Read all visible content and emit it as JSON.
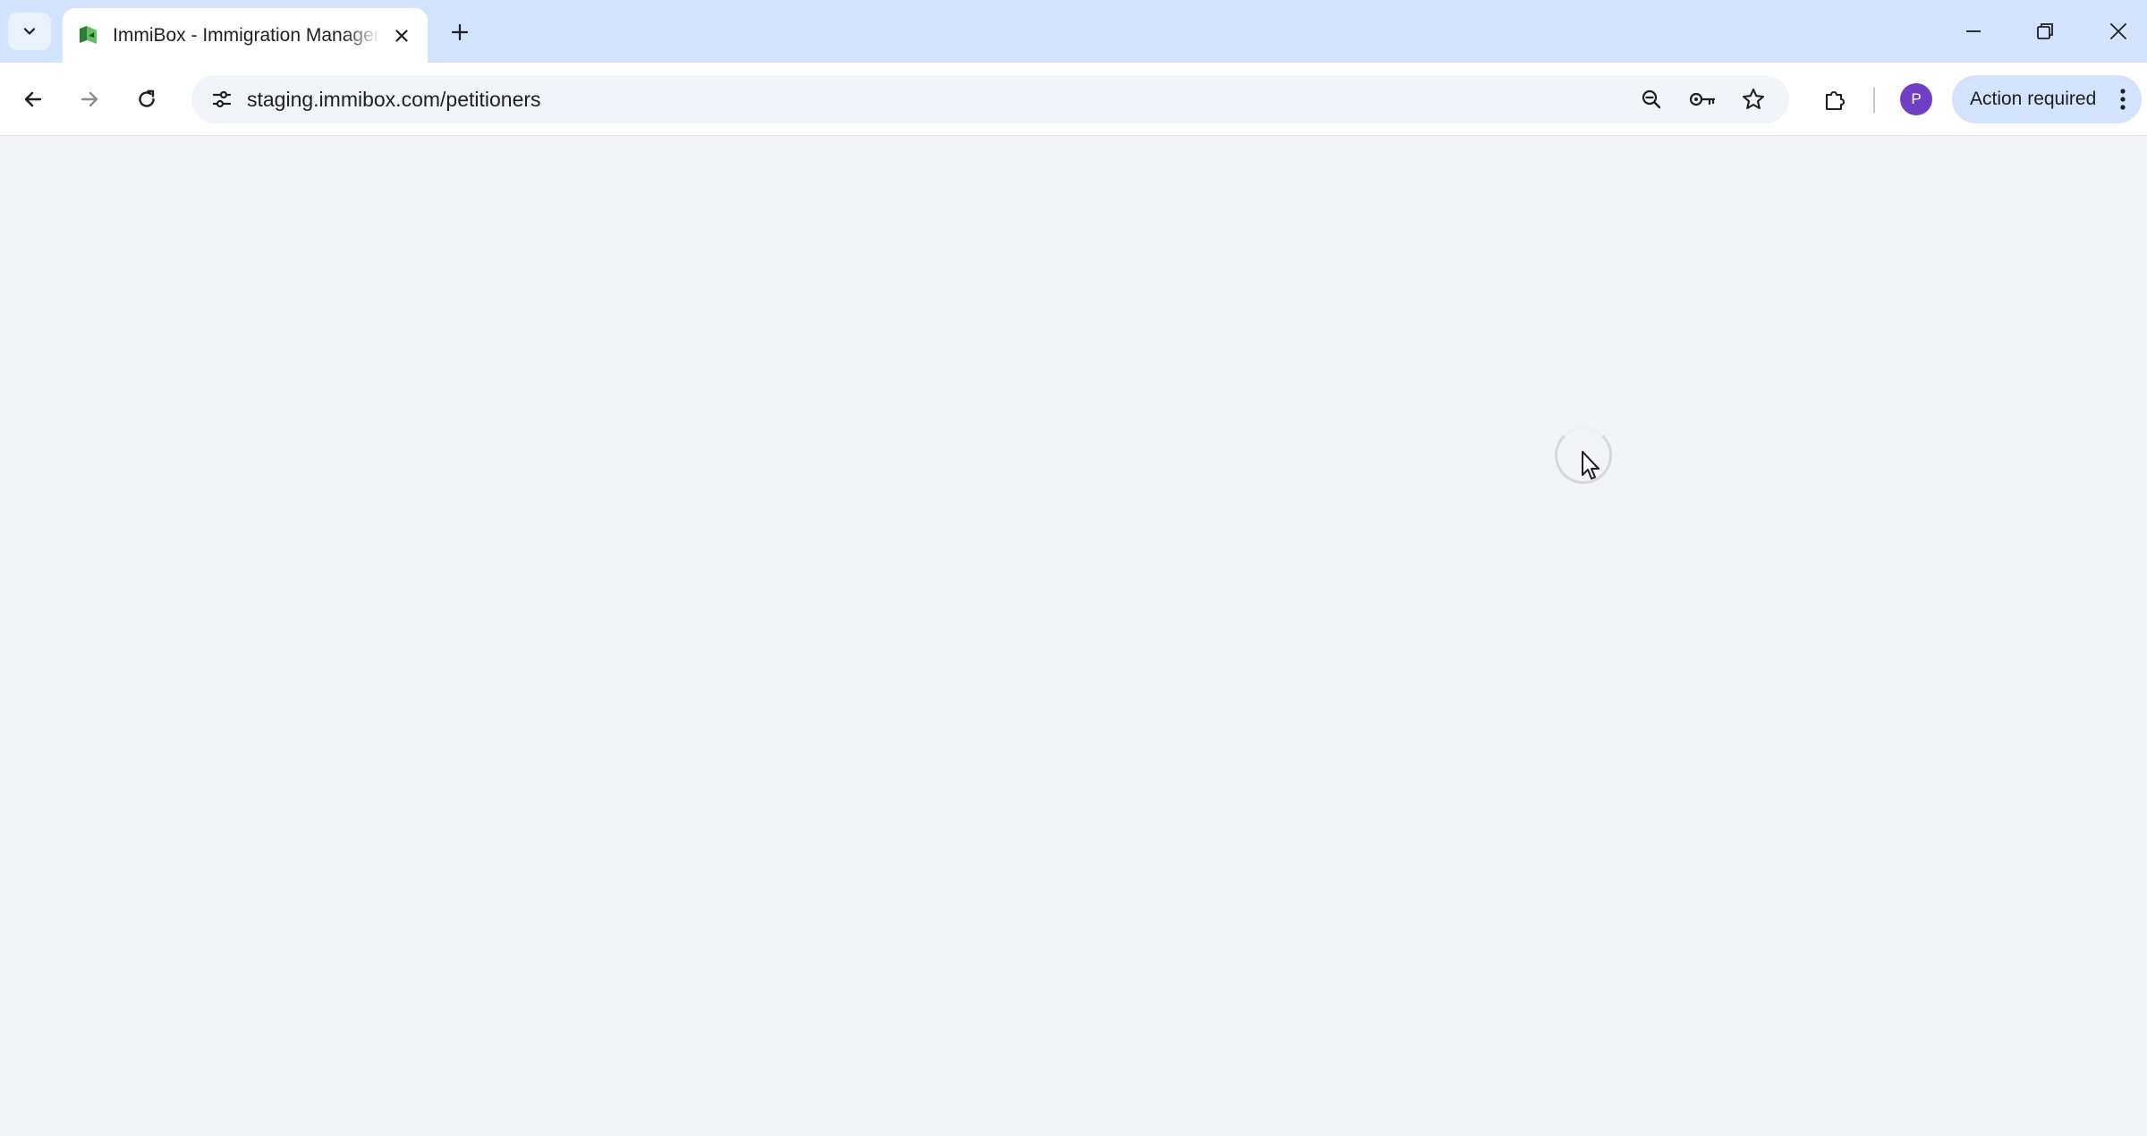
{
  "browser": {
    "tab": {
      "title": "ImmiBox - Immigration Management",
      "favicon": "immibox-logo-icon"
    },
    "address_bar": {
      "url": "staging.immibox.com/petitioners"
    },
    "profile": {
      "initial": "P",
      "color": "#6f3fc4"
    },
    "action_chip": {
      "label": "Action required"
    },
    "icons": {
      "tab_search": "chevron-down-icon",
      "tab_close": "close-icon",
      "new_tab": "plus-icon",
      "minimize": "minimize-icon",
      "restore": "restore-icon",
      "close_window": "close-icon",
      "back": "back-arrow-icon",
      "forward": "forward-arrow-icon",
      "reload": "reload-icon",
      "site_info": "tune-icon",
      "zoom": "zoom-out-icon",
      "password": "key-icon",
      "bookmark": "star-icon",
      "extensions": "puzzle-icon",
      "menu": "more-vert-icon"
    },
    "colors": {
      "tabstrip": "#d3e3fd",
      "page_background": "#f3f4f7"
    }
  },
  "page": {
    "state": "loading"
  }
}
